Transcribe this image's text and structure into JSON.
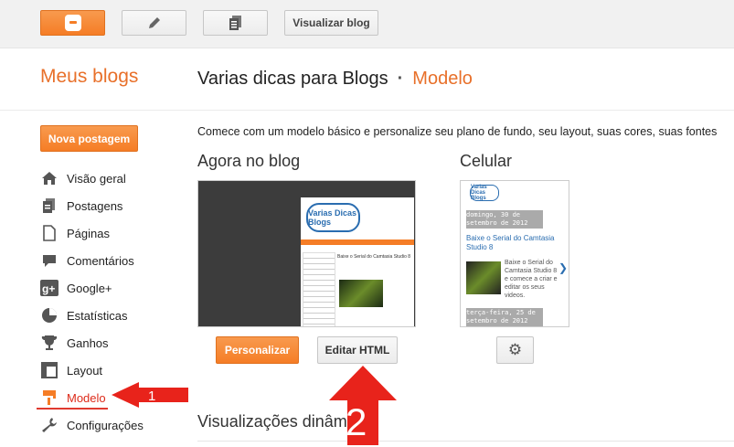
{
  "topbar": {
    "view_blog_label": "Visualizar blog"
  },
  "sidebar": {
    "title": "Meus blogs",
    "new_post_label": "Nova postagem",
    "items": [
      {
        "label": "Visão geral",
        "icon": "home-icon"
      },
      {
        "label": "Postagens",
        "icon": "posts-icon"
      },
      {
        "label": "Páginas",
        "icon": "pages-icon"
      },
      {
        "label": "Comentários",
        "icon": "comments-icon"
      },
      {
        "label": "Google+",
        "icon": "google-plus-icon"
      },
      {
        "label": "Estatísticas",
        "icon": "stats-icon"
      },
      {
        "label": "Ganhos",
        "icon": "trophy-icon"
      },
      {
        "label": "Layout",
        "icon": "layout-icon"
      },
      {
        "label": "Modelo",
        "icon": "template-icon",
        "active": true
      },
      {
        "label": "Configurações",
        "icon": "wrench-icon"
      }
    ]
  },
  "header": {
    "blog_name": "Varias dicas para Blogs",
    "separator": "·",
    "section": "Modelo"
  },
  "main": {
    "intro": "Comece com um modelo básico e personalize seu plano de fundo, seu layout, suas cores, suas fontes",
    "now_title": "Agora no blog",
    "mobile_title": "Celular",
    "customize_label": "Personalizar",
    "edit_html_label": "Editar HTML",
    "dynamic_views_title": "Visualizações dinâmicas"
  },
  "preview_desktop": {
    "logo_text": "Varias Dicas Blogs",
    "post_title": "Baixe o Serial do Camtasia Studio 8"
  },
  "preview_mobile": {
    "logo_text": "Varias Dicas Blogs",
    "date1": "domingo, 30 de setembro de 2012",
    "post_title": "Baixe o Serial do Camtasia Studio 8",
    "post_text": "Baixe o Serial do Camtasia Studio 8 e comece a criar e editar os seus videos.",
    "date2": "terça-feira, 25 de setembro de 2012"
  },
  "annotations": {
    "arrow1_number": "1",
    "arrow2_number": "2"
  },
  "colors": {
    "accent_orange": "#f57d26",
    "annotation_red": "#e8231b"
  }
}
